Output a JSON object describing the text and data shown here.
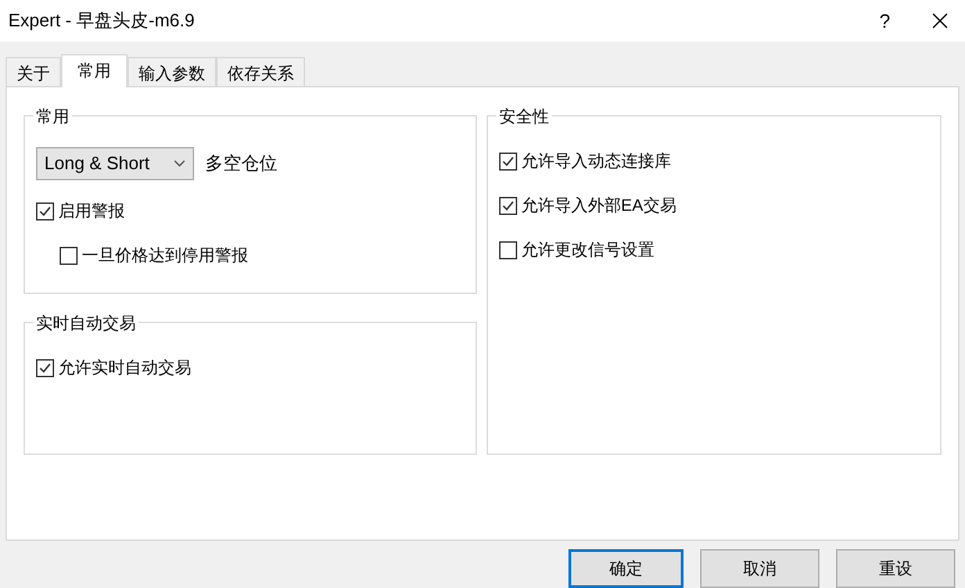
{
  "window": {
    "title": "Expert - 早盘头皮-m6.9",
    "help": "?"
  },
  "tabs": [
    {
      "label": "关于",
      "selected": false
    },
    {
      "label": "常用",
      "selected": true
    },
    {
      "label": "输入参数",
      "selected": false
    },
    {
      "label": "依存关系",
      "selected": false
    }
  ],
  "groups": [
    {
      "title": "常用",
      "items": [
        {
          "kind": "select",
          "value": "Long & Short",
          "caption": "多空仓位"
        },
        {
          "kind": "checkbox",
          "label": "启用警报",
          "checked": true,
          "indented": false
        },
        {
          "kind": "checkbox",
          "label": "一旦价格达到停用警报",
          "checked": false,
          "indented": true
        }
      ]
    },
    {
      "title": "实时自动交易",
      "items": [
        {
          "kind": "checkbox",
          "label": "允许实时自动交易",
          "checked": true,
          "indented": false
        }
      ]
    },
    {
      "title": "安全性",
      "items": [
        {
          "kind": "checkbox",
          "label": "允许导入动态连接库",
          "checked": true,
          "indented": false
        },
        {
          "kind": "checkbox",
          "label": "允许导入外部EA交易",
          "checked": true,
          "indented": false
        },
        {
          "kind": "checkbox",
          "label": "允许更改信号设置",
          "checked": false,
          "indented": false
        }
      ]
    }
  ],
  "buttons": [
    {
      "label": "确定",
      "default": true
    },
    {
      "label": "取消",
      "default": false
    },
    {
      "label": "重设",
      "default": false
    }
  ]
}
